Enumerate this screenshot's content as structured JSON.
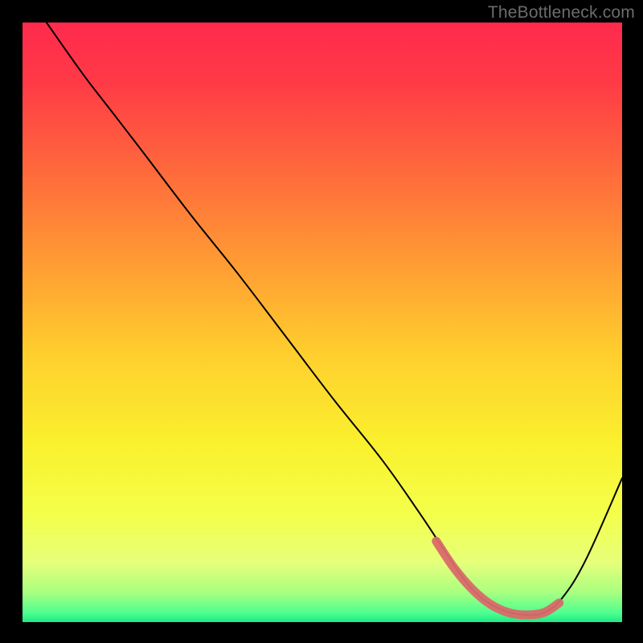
{
  "watermark": "TheBottleneck.com",
  "chart_data": {
    "type": "line",
    "title": "",
    "xlabel": "",
    "ylabel": "",
    "xlim": [
      0,
      100
    ],
    "ylim": [
      0,
      100
    ],
    "grid": false,
    "legend": false,
    "gradient_stops": [
      {
        "offset": 0.0,
        "color": "#ff2a4d"
      },
      {
        "offset": 0.1,
        "color": "#ff3a46"
      },
      {
        "offset": 0.25,
        "color": "#ff6a3c"
      },
      {
        "offset": 0.4,
        "color": "#ff9b33"
      },
      {
        "offset": 0.55,
        "color": "#ffce2e"
      },
      {
        "offset": 0.7,
        "color": "#faf02d"
      },
      {
        "offset": 0.82,
        "color": "#f4ff4a"
      },
      {
        "offset": 0.9,
        "color": "#e6ff7a"
      },
      {
        "offset": 0.95,
        "color": "#aaff80"
      },
      {
        "offset": 0.985,
        "color": "#4dff8f"
      },
      {
        "offset": 1.0,
        "color": "#1de986"
      }
    ],
    "series": [
      {
        "name": "bottleneck-curve",
        "color": "#000000",
        "stroke_width": 2,
        "x": [
          4.0,
          10.0,
          15.0,
          20.0,
          28.0,
          36.0,
          44.0,
          52.0,
          60.0,
          66.0,
          70.0,
          73.0,
          76.0,
          80.0,
          84.0,
          87.0,
          90.0,
          94.0,
          100.0
        ],
        "values": [
          100.0,
          91.5,
          85.0,
          78.5,
          68.0,
          58.0,
          47.5,
          37.0,
          27.0,
          18.5,
          12.5,
          8.0,
          4.5,
          2.0,
          1.2,
          1.6,
          4.0,
          10.5,
          24.0
        ]
      },
      {
        "name": "sweet-spot-highlight",
        "color": "#d96a6a",
        "stroke_width": 11,
        "linecap": "round",
        "x": [
          69.0,
          72.0,
          75.0,
          78.0,
          81.0,
          84.0,
          87.0,
          89.5
        ],
        "values": [
          13.5,
          9.0,
          5.5,
          3.0,
          1.6,
          1.2,
          1.6,
          3.2
        ]
      }
    ],
    "annotations": []
  }
}
